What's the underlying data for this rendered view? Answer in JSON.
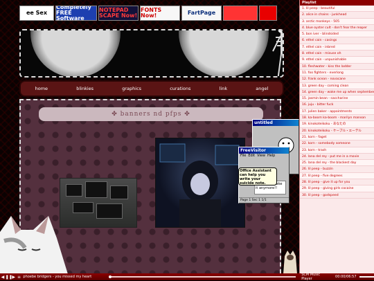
{
  "blinkies": [
    {
      "text": "ee Sex",
      "bg": "#ffffff",
      "fg": "#000000",
      "width": 50
    },
    {
      "text": "Completely FREE Software",
      "bg": "#1d3fb0",
      "fg": "#ffffff",
      "width": 60
    },
    {
      "text": "NOTEPAD SCAPE Now!",
      "bg": "#13113a",
      "fg": "#ff3b3b",
      "width": 58
    },
    {
      "text": "FONTS Now!",
      "bg": "#f7f7f7",
      "fg": "#cc0000",
      "width": 58
    },
    {
      "text": "FartPage",
      "bg": "#f7f7f7",
      "fg": "#0b2e7a",
      "width": 58
    },
    {
      "text": "",
      "bg": "#ff3333",
      "fg": "#ffffff",
      "width": 50
    },
    {
      "text": "",
      "bg": "#e80000",
      "fg": "#ffffff",
      "width": 26
    }
  ],
  "nav": [
    "home",
    "blinkies",
    "graphics",
    "curations",
    "link",
    "angel"
  ],
  "content_title": "banners nd pfps",
  "windows": {
    "untitled_title": "untitled",
    "paint_title": "FreeVisitor",
    "paint_menu": [
      "File",
      "Edit",
      "View",
      "Help"
    ],
    "paint_canvas_text": "i just can't take it anymore!!",
    "paint_status": "Page 1 Sec 1  1/1",
    "office_tip": "Office Assistant can help you write your suicide note."
  },
  "player": {
    "now_playing": "phoebe bridgers - you missed my heart",
    "name": "SCM Music Player",
    "time": "00:00/06:57"
  },
  "playlist": {
    "title": "Playlist",
    "items": [
      "1. lil peep - beautiful",
      "2. alice in chains - junkhead",
      "3. arctic monkeys - 505",
      "4. blue oyster cult - don't fear the reaper",
      "5. bon iver - blindsided",
      "6. ethel cain - casings",
      "7. ethel cain - inbred",
      "8. ethel cain - misuse oh",
      "9. ethel cain - unpunishable",
      "10. fleshwater - kiss the ladder",
      "11. foo fighters - everlong",
      "12. frank ocean - novacane",
      "13. green day - coming clean",
      "14. green day - wake me up when september",
      "15. jasmin bean - saccharine",
      "16. juju - bitter fuck",
      "17. julien baker - appointments",
      "18. ka-boom ka-boom - marilyn manson",
      "19. kinokoteikoku - あなたの",
      "20. kinokoteikoku - ケーブル・エーテル",
      "21. korn - faget",
      "22. korn - somebody someone",
      "23. korn - trash",
      "24. lana del rey - put me in a movie",
      "25. lana del rey - the blackest day",
      "26. lil peep - buzzin",
      "27. lil peep - five degrees",
      "28. lil peep - give it up for you",
      "29. lil peep - giving girls cocaine",
      "30. lil peep - godspeed"
    ]
  }
}
